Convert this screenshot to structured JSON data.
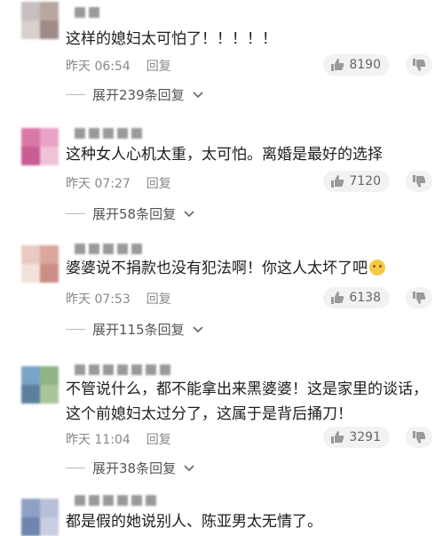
{
  "comments": [
    {
      "text": "这样的媳妇太可怕了！！！！！",
      "time": "昨天 06:54",
      "reply_label": "回复",
      "likes": "8190",
      "expand_label": "展开239条回复",
      "colors": {
        "avatar": [
          "#c8bfc0",
          "#b8a6a0",
          "#d8d0cc",
          "#9e8b87"
        ]
      }
    },
    {
      "text": "这种女人心机太重，太可怕。离婚是最好的选择",
      "time": "昨天 07:27",
      "reply_label": "回复",
      "likes": "7120",
      "expand_label": "展开58条回复",
      "colors": {
        "avatar": [
          "#d977a6",
          "#e9a3c6",
          "#c85d93",
          "#f0c2d8"
        ]
      }
    },
    {
      "text": "婆婆说不捐款也没有犯法啊！你这人太坏了吧",
      "emoji_icon": "smirk-emoji-icon",
      "time": "昨天 07:53",
      "reply_label": "回复",
      "likes": "6138",
      "expand_label": "展开115条回复",
      "colors": {
        "avatar": [
          "#e9c9c2",
          "#d9a79c",
          "#f2e2dc",
          "#c98f85"
        ]
      }
    },
    {
      "text": "不管说什么，都不能拿出来黑婆婆！这是家里的谈话，这个前媳妇太过分了，这属于是背后捅刀！",
      "time": "昨天 11:04",
      "reply_label": "回复",
      "likes": "3291",
      "expand_label": "展开38条回复",
      "colors": {
        "avatar": [
          "#7aa3c8",
          "#8fb487",
          "#5d7f9e",
          "#a9c59a"
        ]
      }
    },
    {
      "text": "都是假的她说别人、陈亚男太无情了。",
      "colors": {
        "avatar": [
          "#8fa0c4",
          "#b6c0d8",
          "#7084ad",
          "#c9cfe0"
        ]
      }
    }
  ],
  "icons": {
    "like": "thumbs-up-icon",
    "dislike": "thumbs-down-icon",
    "expand": "chevron-down-icon"
  }
}
